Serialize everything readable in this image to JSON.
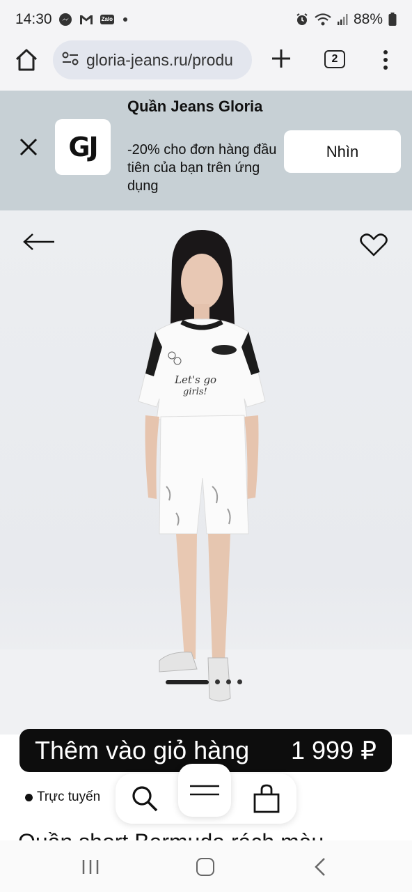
{
  "status": {
    "time": "14:30",
    "battery": "88%",
    "zalo": "Zalo"
  },
  "browser": {
    "url": "gloria-jeans.ru/produ",
    "tab_count": "2"
  },
  "banner": {
    "title": "Quần Jeans Gloria",
    "logo_text": "GJ",
    "description": "-20% cho đơn hàng đầu tiên của bạn trên ứng dụng",
    "button_label": "Nhìn"
  },
  "product": {
    "image_pager": {
      "total": 4,
      "active": 1
    },
    "cart_label": "Thêm vào giỏ hàng",
    "price": "1 999 ₽",
    "availability": "Trực tuyến",
    "title": "Quần short Bermuda rách màu"
  },
  "icons": {
    "home": "home-icon",
    "site_settings": "tune-icon",
    "new_tab": "plus-icon",
    "tabs": "tabs-icon",
    "menu": "more-vert-icon",
    "close": "close-icon",
    "back": "arrow-left-icon",
    "favorite": "heart-icon",
    "search": "search-icon",
    "catalog_menu": "menu-icon",
    "cart": "bag-icon"
  },
  "colors": {
    "banner_bg": "#c7d0d5",
    "cart_bar": "#0d0d0d",
    "image_bg": "#eceef1"
  }
}
